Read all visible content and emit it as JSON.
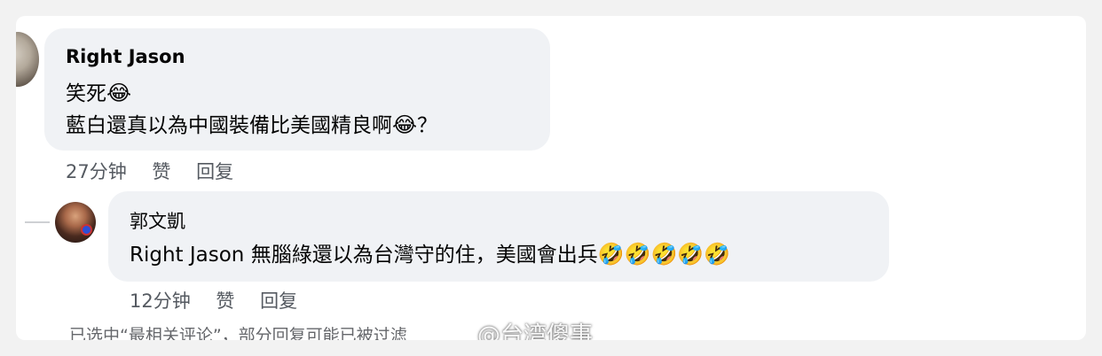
{
  "top_remnant": "",
  "comment1": {
    "author": "Right Jason",
    "line1_text": "笑死",
    "line1_emoji": "😂",
    "line2_text": "藍白還真以為中國裝備比美國精良啊",
    "line2_emoji": "😂",
    "line2_suffix": "？",
    "time": "27分钟",
    "like": "赞",
    "reply": "回复"
  },
  "comment2": {
    "author": "郭文凱",
    "mention": "Right Jason",
    "text": " 無腦綠還以為台灣守的住，美國會出兵",
    "emojis": "🤣🤣🤣🤣🤣",
    "time": "12分钟",
    "like": "赞",
    "reply": "回复"
  },
  "footer_text": "已选中“最相关评论”，部分回复可能已被过滤",
  "watermark": "@台湾傻事"
}
